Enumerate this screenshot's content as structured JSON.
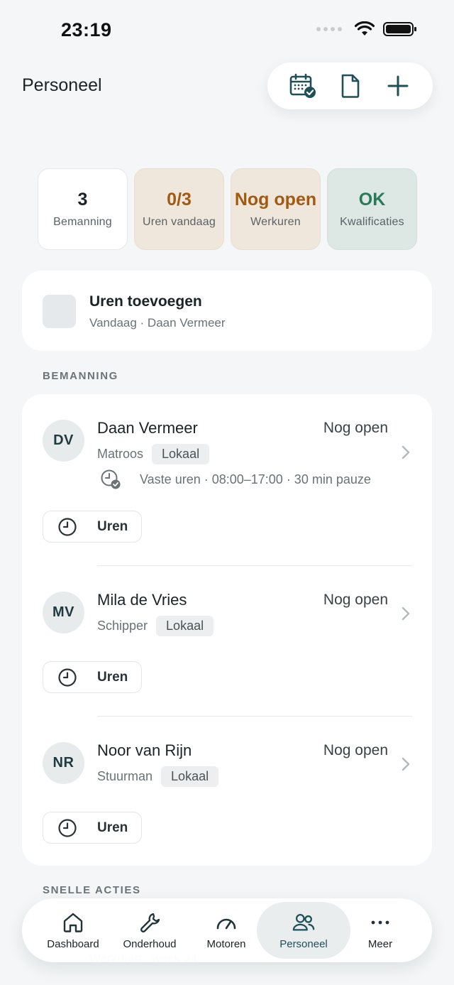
{
  "status_bar": {
    "time": "23:19"
  },
  "header": {
    "title": "Personeel"
  },
  "header_actions": [
    "calendar-check-icon",
    "document-icon",
    "plus-icon"
  ],
  "stats": [
    {
      "value": "3",
      "label": "Bemanning",
      "style": "white",
      "value_color": "#1c2326"
    },
    {
      "value": "0/3",
      "label": "Uren vandaag",
      "style": "beige",
      "value_color": "#a25a10"
    },
    {
      "value": "Nog open",
      "label": "Werkuren",
      "style": "beige",
      "value_color": "#a25a10"
    },
    {
      "value": "OK",
      "label": "Kwalificaties",
      "style": "teal",
      "value_color": "#2a7a5a"
    }
  ],
  "add_hours": {
    "title": "Uren toevoegen",
    "subtitle": "Vandaag · Daan Vermeer"
  },
  "sections": {
    "crew": "BEMANNING",
    "quick_actions": "SNELLE ACTIES"
  },
  "crew": [
    {
      "initials": "DV",
      "name": "Daan Vermeer",
      "status": "Nog open",
      "role": "Matroos",
      "tag": "Lokaal",
      "schedule": "Vaste uren · 08:00–17:00 · 30 min pauze",
      "hours_button": "Uren"
    },
    {
      "initials": "MV",
      "name": "Mila de Vries",
      "status": "Nog open",
      "role": "Schipper",
      "tag": "Lokaal",
      "hours_button": "Uren"
    },
    {
      "initials": "NR",
      "name": "Noor van Rijn",
      "status": "Nog open",
      "role": "Stuurman",
      "tag": "Lokaal",
      "hours_button": "Uren"
    }
  ],
  "behind_text": "Werkuren · week 34",
  "tabbar": {
    "tabs": [
      {
        "label": "Dashboard",
        "icon": "home-icon"
      },
      {
        "label": "Onderhoud",
        "icon": "wrench-icon"
      },
      {
        "label": "Motoren",
        "icon": "gauge-icon"
      },
      {
        "label": "Personeel",
        "icon": "people-icon",
        "active": true
      },
      {
        "label": "Meer",
        "icon": "more-icon"
      }
    ]
  },
  "colors": {
    "accent": "#1f4f57",
    "amber": "#a25a10",
    "green": "#2a7a5a",
    "background": "#f4f6f7"
  }
}
